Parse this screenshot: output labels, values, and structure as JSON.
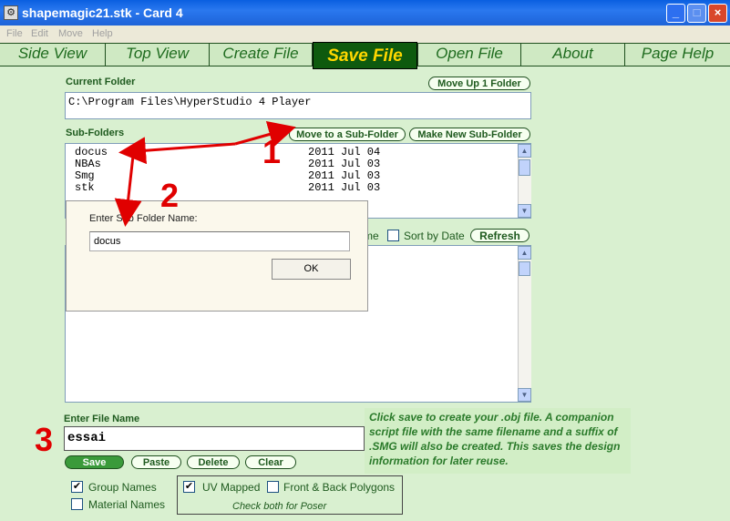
{
  "window": {
    "title": "shapemagic21.stk - Card 4",
    "min": "_",
    "max": "□",
    "close": "×"
  },
  "menu": [
    "File",
    "Edit",
    "Move",
    "Help"
  ],
  "tabs": [
    "Side View",
    "Top View",
    "Create File",
    "Save File",
    "Open File",
    "About",
    "Page Help"
  ],
  "current_folder": {
    "label": "Current Folder",
    "path": "C:\\Program Files\\HyperStudio 4 Player",
    "move_up": "Move Up 1 Folder"
  },
  "subfolders": {
    "label": "Sub-Folders",
    "move_to": "Move to a Sub-Folder",
    "make_new": "Make New Sub-Folder",
    "items": [
      {
        "name": "docus",
        "date": "2011 Jul 04"
      },
      {
        "name": "NBAs",
        "date": "2011 Jul 03"
      },
      {
        "name": "Smg",
        "date": "2011 Jul 03"
      },
      {
        "name": "stk",
        "date": "2011 Jul 03"
      }
    ]
  },
  "files": {
    "name_suffix": "me",
    "sort_by_date": "Sort by Date",
    "refresh": "Refresh"
  },
  "dialog": {
    "prompt": "Enter Sub Folder Name:",
    "value": "docus",
    "ok": "OK"
  },
  "file_name": {
    "label": "Enter File Name",
    "value": "essai"
  },
  "buttons": {
    "save": "Save",
    "paste": "Paste",
    "delete": "Delete",
    "clear": "Clear"
  },
  "info": "Click save to create your .obj file. A companion script file with the same filename and a suffix of .SMG will also be created. This saves the design information for later reuse.",
  "options": {
    "group_names": "Group Names",
    "material_names": "Material  Names",
    "uv_mapped": "UV Mapped",
    "front_back": "Front & Back  Polygons",
    "poser_note": "Check both for Poser"
  },
  "annotations": [
    "1",
    "2",
    "3"
  ],
  "colors": {
    "accent": "#0e5a0e",
    "save_tab_text": "#ffd700",
    "annotation": "#e00000",
    "background": "#d9f0d0"
  }
}
